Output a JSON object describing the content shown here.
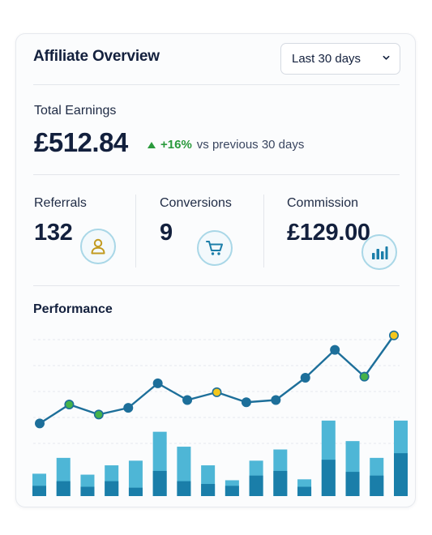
{
  "header": {
    "title": "Affiliate Overview",
    "range_select": {
      "value": "Last 30 days",
      "icon": "chevron-down-icon"
    }
  },
  "total_earnings": {
    "label": "Total Earnings",
    "value": "£512.84",
    "change_pct": "+16%",
    "change_text": "vs previous 30 days",
    "trend_icon": "triangle-up-icon"
  },
  "stats": [
    {
      "label": "Referrals",
      "value": "132",
      "icon": "user-icon"
    },
    {
      "label": "Conversions",
      "value": "9",
      "icon": "cart-icon"
    },
    {
      "label": "Commission",
      "value": "£129.00",
      "icon": "bar-chart-icon"
    }
  ],
  "performance": {
    "title": "Performance"
  },
  "colors": {
    "text": "#13203d",
    "positive": "#2a9a3c",
    "line": "#1d6f9a",
    "point_default": "#1d6f9a",
    "point_green": "#45b24a",
    "point_yellow": "#f3c61c",
    "bar_light": "#4eb6d6",
    "bar_dark": "#1a7ea9",
    "icon_ring": "#a9d7e7",
    "icon_user": "#c29a1f",
    "icon_teal": "#1b7ea9"
  },
  "chart_data": {
    "type": "line",
    "line": {
      "values": [
        23,
        40,
        31,
        37,
        59,
        44,
        51,
        42,
        44,
        64,
        89,
        65,
        102
      ],
      "markers": [
        "blue",
        "green",
        "green",
        "blue",
        "blue",
        "blue",
        "yellow",
        "blue",
        "blue",
        "blue",
        "blue",
        "green",
        "yellow"
      ],
      "ylim": [
        0,
        120
      ]
    },
    "bars": {
      "light": [
        24,
        41,
        23,
        33,
        38,
        69,
        53,
        33,
        17,
        38,
        50,
        18,
        81,
        59,
        41,
        81
      ],
      "dark": [
        11,
        16,
        10,
        16,
        9,
        27,
        16,
        13,
        11,
        22,
        27,
        10,
        39,
        26,
        22,
        46
      ],
      "ylim": [
        0,
        100
      ]
    },
    "grid": true,
    "legend": "none"
  }
}
